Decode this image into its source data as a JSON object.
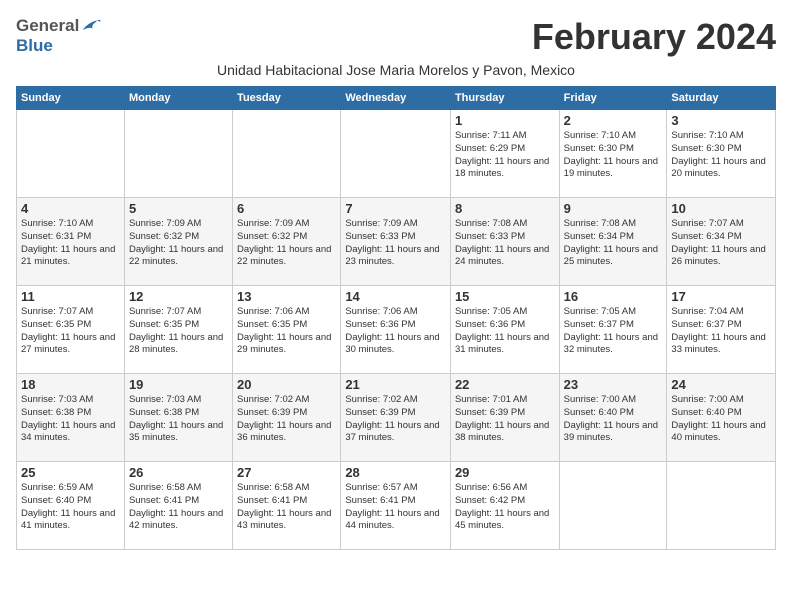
{
  "header": {
    "logo_general": "General",
    "logo_blue": "Blue",
    "title": "February 2024",
    "subtitle": "Unidad Habitacional Jose Maria Morelos y Pavon, Mexico"
  },
  "days_of_week": [
    "Sunday",
    "Monday",
    "Tuesday",
    "Wednesday",
    "Thursday",
    "Friday",
    "Saturday"
  ],
  "weeks": [
    {
      "days": [
        {
          "number": "",
          "info": ""
        },
        {
          "number": "",
          "info": ""
        },
        {
          "number": "",
          "info": ""
        },
        {
          "number": "",
          "info": ""
        },
        {
          "number": "1",
          "info": "Sunrise: 7:11 AM\nSunset: 6:29 PM\nDaylight: 11 hours and 18 minutes."
        },
        {
          "number": "2",
          "info": "Sunrise: 7:10 AM\nSunset: 6:30 PM\nDaylight: 11 hours and 19 minutes."
        },
        {
          "number": "3",
          "info": "Sunrise: 7:10 AM\nSunset: 6:30 PM\nDaylight: 11 hours and 20 minutes."
        }
      ]
    },
    {
      "days": [
        {
          "number": "4",
          "info": "Sunrise: 7:10 AM\nSunset: 6:31 PM\nDaylight: 11 hours and 21 minutes."
        },
        {
          "number": "5",
          "info": "Sunrise: 7:09 AM\nSunset: 6:32 PM\nDaylight: 11 hours and 22 minutes."
        },
        {
          "number": "6",
          "info": "Sunrise: 7:09 AM\nSunset: 6:32 PM\nDaylight: 11 hours and 22 minutes."
        },
        {
          "number": "7",
          "info": "Sunrise: 7:09 AM\nSunset: 6:33 PM\nDaylight: 11 hours and 23 minutes."
        },
        {
          "number": "8",
          "info": "Sunrise: 7:08 AM\nSunset: 6:33 PM\nDaylight: 11 hours and 24 minutes."
        },
        {
          "number": "9",
          "info": "Sunrise: 7:08 AM\nSunset: 6:34 PM\nDaylight: 11 hours and 25 minutes."
        },
        {
          "number": "10",
          "info": "Sunrise: 7:07 AM\nSunset: 6:34 PM\nDaylight: 11 hours and 26 minutes."
        }
      ]
    },
    {
      "days": [
        {
          "number": "11",
          "info": "Sunrise: 7:07 AM\nSunset: 6:35 PM\nDaylight: 11 hours and 27 minutes."
        },
        {
          "number": "12",
          "info": "Sunrise: 7:07 AM\nSunset: 6:35 PM\nDaylight: 11 hours and 28 minutes."
        },
        {
          "number": "13",
          "info": "Sunrise: 7:06 AM\nSunset: 6:35 PM\nDaylight: 11 hours and 29 minutes."
        },
        {
          "number": "14",
          "info": "Sunrise: 7:06 AM\nSunset: 6:36 PM\nDaylight: 11 hours and 30 minutes."
        },
        {
          "number": "15",
          "info": "Sunrise: 7:05 AM\nSunset: 6:36 PM\nDaylight: 11 hours and 31 minutes."
        },
        {
          "number": "16",
          "info": "Sunrise: 7:05 AM\nSunset: 6:37 PM\nDaylight: 11 hours and 32 minutes."
        },
        {
          "number": "17",
          "info": "Sunrise: 7:04 AM\nSunset: 6:37 PM\nDaylight: 11 hours and 33 minutes."
        }
      ]
    },
    {
      "days": [
        {
          "number": "18",
          "info": "Sunrise: 7:03 AM\nSunset: 6:38 PM\nDaylight: 11 hours and 34 minutes."
        },
        {
          "number": "19",
          "info": "Sunrise: 7:03 AM\nSunset: 6:38 PM\nDaylight: 11 hours and 35 minutes."
        },
        {
          "number": "20",
          "info": "Sunrise: 7:02 AM\nSunset: 6:39 PM\nDaylight: 11 hours and 36 minutes."
        },
        {
          "number": "21",
          "info": "Sunrise: 7:02 AM\nSunset: 6:39 PM\nDaylight: 11 hours and 37 minutes."
        },
        {
          "number": "22",
          "info": "Sunrise: 7:01 AM\nSunset: 6:39 PM\nDaylight: 11 hours and 38 minutes."
        },
        {
          "number": "23",
          "info": "Sunrise: 7:00 AM\nSunset: 6:40 PM\nDaylight: 11 hours and 39 minutes."
        },
        {
          "number": "24",
          "info": "Sunrise: 7:00 AM\nSunset: 6:40 PM\nDaylight: 11 hours and 40 minutes."
        }
      ]
    },
    {
      "days": [
        {
          "number": "25",
          "info": "Sunrise: 6:59 AM\nSunset: 6:40 PM\nDaylight: 11 hours and 41 minutes."
        },
        {
          "number": "26",
          "info": "Sunrise: 6:58 AM\nSunset: 6:41 PM\nDaylight: 11 hours and 42 minutes."
        },
        {
          "number": "27",
          "info": "Sunrise: 6:58 AM\nSunset: 6:41 PM\nDaylight: 11 hours and 43 minutes."
        },
        {
          "number": "28",
          "info": "Sunrise: 6:57 AM\nSunset: 6:41 PM\nDaylight: 11 hours and 44 minutes."
        },
        {
          "number": "29",
          "info": "Sunrise: 6:56 AM\nSunset: 6:42 PM\nDaylight: 11 hours and 45 minutes."
        },
        {
          "number": "",
          "info": ""
        },
        {
          "number": "",
          "info": ""
        }
      ]
    }
  ]
}
